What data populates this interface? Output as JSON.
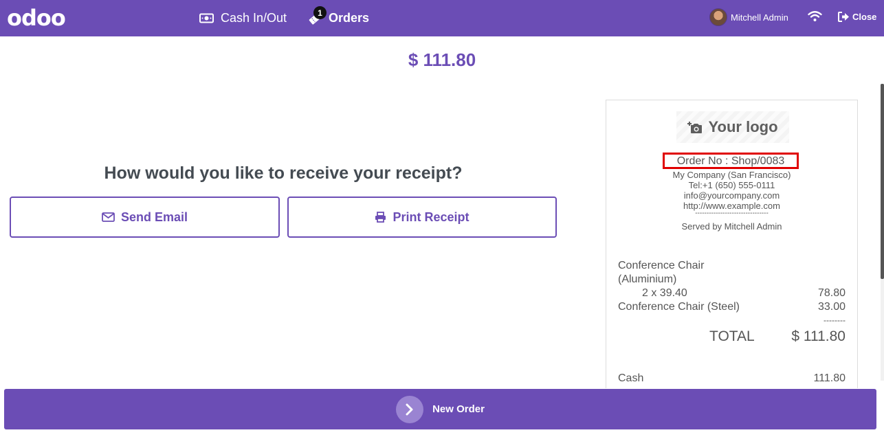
{
  "navbar": {
    "logo": "odoo",
    "cash_label": "Cash In/Out",
    "orders_label": "Orders",
    "orders_badge": "1",
    "user_name": "Mitchell Admin",
    "close_label": "Close",
    "icons": [
      "money-icon",
      "ticket-icon",
      "avatar",
      "wifi-icon",
      "sign-out-icon"
    ]
  },
  "payment": {
    "amount": "$ 111.80",
    "question": "How would you like to receive your receipt?",
    "send_email_label": "Send Email",
    "print_receipt_label": "Print Receipt"
  },
  "receipt": {
    "logo_text": "Your logo",
    "order_no": "Order No : Shop/0083",
    "company": "My Company (San Francisco)",
    "tel": "Tel:+1 (650) 555-0111",
    "email": "info@yourcompany.com",
    "website": "http://www.example.com",
    "separator": "--------------------------------",
    "served_by": "Served by Mitchell Admin",
    "lines": [
      {
        "product": "Conference Chair",
        "product_cont": "(Aluminium)",
        "qty_price": "2 x 39.40",
        "amount": "78.80"
      },
      {
        "product": "Conference Chair (Steel)",
        "amount": "33.00"
      }
    ],
    "line_separator": "--------",
    "total_label": "TOTAL",
    "total_value": "$ 111.80",
    "payment_method": "Cash",
    "payment_amount": "111.80"
  },
  "footer": {
    "new_order_label": "New Order"
  },
  "colors": {
    "brand": "#6b4db5",
    "highlight": "#e00000"
  }
}
